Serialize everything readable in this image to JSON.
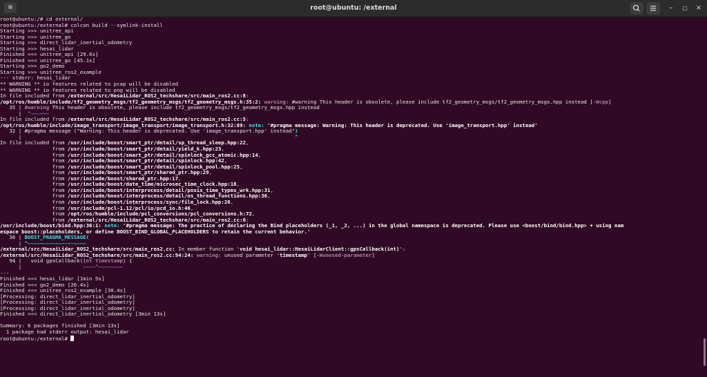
{
  "window": {
    "title": "root@ubuntu: /external",
    "new_tab_icon": "new-tab-icon",
    "search_icon": "search-icon",
    "menu_icon": "hamburger-menu-icon",
    "min_glyph": "–",
    "max_glyph": "▢",
    "close_glyph": "×"
  },
  "colors": {
    "background": "#300a24",
    "text": "#e7e7e7",
    "warning": "#ad7fa8",
    "note": "#34e2e2",
    "caret": "#4e9a06"
  },
  "terminal": {
    "lines": [
      [
        {
          "t": "root@ubuntu:/# cd external/"
        }
      ],
      [
        {
          "t": "root@ubuntu:/external# colcon build --symlink-install"
        }
      ],
      [
        {
          "t": "Starting >>> unitree_api"
        }
      ],
      [
        {
          "t": "Starting >>> unitree_go"
        }
      ],
      [
        {
          "t": "Starting >>> direct_lidar_inertial_odometry"
        }
      ],
      [
        {
          "t": "Starting >>> hesai_lidar"
        }
      ],
      [
        {
          "t": "Finished <<< unitree_api [29.6s]"
        }
      ],
      [
        {
          "t": "Finished <<< unitree_go [45.1s]"
        }
      ],
      [
        {
          "t": "Starting >>> go2_demo"
        }
      ],
      [
        {
          "t": "Starting >>> unitree_ros2_example"
        }
      ],
      [
        {
          "t": "--- stderr: hesai_lidar"
        }
      ],
      [
        {
          "t": "** WARNING ** io features related to pcap will be disabled"
        }
      ],
      [
        {
          "t": "** WARNING ** io features related to png will be disabled"
        }
      ],
      [
        {
          "t": "In file included from "
        },
        {
          "t": "/external/src/HesaiLidar_ROS2_techshare/src/main_ros2.cc:8",
          "c": "b"
        },
        {
          "t": ":"
        }
      ],
      [
        {
          "t": "/opt/ros/humble/include/tf2_geometry_msgs/tf2_geometry_msgs/tf2_geometry_msgs.h:35:2:",
          "c": "b"
        },
        {
          "t": " "
        },
        {
          "t": "warning:",
          "c": "warn"
        },
        {
          "t": " #warning This header is obsolete, please include tf2_geometry_msgs/tf2_geometry_msgs.hpp instead ["
        },
        {
          "t": "-Wcpp",
          "c": "warn"
        },
        {
          "t": "]"
        }
      ],
      [
        {
          "t": "   35 | "
        },
        {
          "t": "#warning",
          "c": "warn"
        },
        {
          "t": " This header is obsolete, please include tf2_geometry_msgs/tf2_geometry_msgs.hpp instead"
        }
      ],
      [
        {
          "t": "      | "
        },
        {
          "t": " ^~~~~~~",
          "c": "warn"
        }
      ],
      [
        {
          "t": "In file included from "
        },
        {
          "t": "/external/src/HesaiLidar_ROS2_techshare/src/main_ros2.cc:5",
          "c": "b"
        },
        {
          "t": ":"
        }
      ],
      [
        {
          "t": "/opt/ros/humble/include/image_transport/image_transport/image_transport.h:32:89:",
          "c": "b"
        },
        {
          "t": " "
        },
        {
          "t": "note:",
          "c": "note"
        },
        {
          "t": " "
        },
        {
          "t": "'#pragma message: Warning: This header is deprecated. Use 'image_transport.hpp' instead'",
          "c": "b"
        }
      ],
      [
        {
          "t": "   32 | #pragma message (\"Warning: This header is deprecated. Use 'image_transport.hpp' instead\""
        },
        {
          "t": ")",
          "c": "note"
        }
      ],
      [
        {
          "t": "      |                                                                                         "
        },
        {
          "t": "^",
          "c": "note"
        }
      ],
      [
        {
          "t": "In file included from "
        },
        {
          "t": "/usr/include/boost/smart_ptr/detail/sp_thread_sleep.hpp:22",
          "c": "b"
        },
        {
          "t": ","
        }
      ],
      [
        {
          "t": "                 from "
        },
        {
          "t": "/usr/include/boost/smart_ptr/detail/yield_k.hpp:23",
          "c": "b"
        },
        {
          "t": ","
        }
      ],
      [
        {
          "t": "                 from "
        },
        {
          "t": "/usr/include/boost/smart_ptr/detail/spinlock_gcc_atomic.hpp:14",
          "c": "b"
        },
        {
          "t": ","
        }
      ],
      [
        {
          "t": "                 from "
        },
        {
          "t": "/usr/include/boost/smart_ptr/detail/spinlock.hpp:42",
          "c": "b"
        },
        {
          "t": ","
        }
      ],
      [
        {
          "t": "                 from "
        },
        {
          "t": "/usr/include/boost/smart_ptr/detail/spinlock_pool.hpp:25",
          "c": "b"
        },
        {
          "t": ","
        }
      ],
      [
        {
          "t": "                 from "
        },
        {
          "t": "/usr/include/boost/smart_ptr/shared_ptr.hpp:29",
          "c": "b"
        },
        {
          "t": ","
        }
      ],
      [
        {
          "t": "                 from "
        },
        {
          "t": "/usr/include/boost/shared_ptr.hpp:17",
          "c": "b"
        },
        {
          "t": ","
        }
      ],
      [
        {
          "t": "                 from "
        },
        {
          "t": "/usr/include/boost/date_time/microsec_time_clock.hpp:18",
          "c": "b"
        },
        {
          "t": ","
        }
      ],
      [
        {
          "t": "                 from "
        },
        {
          "t": "/usr/include/boost/interprocess/detail/posix_time_types_wrk.hpp:31",
          "c": "b"
        },
        {
          "t": ","
        }
      ],
      [
        {
          "t": "                 from "
        },
        {
          "t": "/usr/include/boost/interprocess/detail/os_thread_functions.hpp:36",
          "c": "b"
        },
        {
          "t": ","
        }
      ],
      [
        {
          "t": "                 from "
        },
        {
          "t": "/usr/include/boost/interprocess/sync/file_lock.hpp:26",
          "c": "b"
        },
        {
          "t": ","
        }
      ],
      [
        {
          "t": "                 from "
        },
        {
          "t": "/usr/include/pcl-1.12/pcl/io/pcd_io.h:46",
          "c": "b"
        },
        {
          "t": ","
        }
      ],
      [
        {
          "t": "                 from "
        },
        {
          "t": "/opt/ros/humble/include/pcl_conversions/pcl_conversions.h:72",
          "c": "b"
        },
        {
          "t": ","
        }
      ],
      [
        {
          "t": "                 from "
        },
        {
          "t": "/external/src/HesaiLidar_ROS2_techshare/src/main_ros2.cc:6",
          "c": "b"
        },
        {
          "t": ":"
        }
      ],
      [
        {
          "t": "/usr/include/boost/bind.hpp:36:1:",
          "c": "b"
        },
        {
          "t": " "
        },
        {
          "t": "note:",
          "c": "note"
        },
        {
          "t": " "
        },
        {
          "t": "'#pragma message: The practice of declaring the Bind placeholders (_1, _2, ...) in the global namespace is deprecated. Please use <boost/bind/bind.hpp> + using nam",
          "c": "b"
        }
      ],
      [
        {
          "t": "espace boost::placeholders, or define BOOST_BIND_GLOBAL_PLACEHOLDERS to retain the current behavior.'",
          "c": "b"
        }
      ],
      [
        {
          "t": "   36 | "
        },
        {
          "t": "BOOST_PRAGMA_MESSAGE",
          "c": "note"
        },
        {
          "t": "("
        }
      ],
      [
        {
          "t": "      | "
        },
        {
          "t": "^~~~~~~~~~~~~~~~~~~~",
          "c": "note"
        }
      ],
      [
        {
          "t": "/external/src/HesaiLidar_ROS2_techshare/src/main_ros2.cc:",
          "c": "b"
        },
        {
          "t": " In member function '"
        },
        {
          "t": "void hesai_lidar::HesaiLidarClient::gpsCallback(int)",
          "c": "b"
        },
        {
          "t": "':"
        }
      ],
      [
        {
          "t": "/external/src/HesaiLidar_ROS2_techshare/src/main_ros2.cc:94:24:",
          "c": "b"
        },
        {
          "t": " "
        },
        {
          "t": "warning:",
          "c": "warn"
        },
        {
          "t": " unused parameter '"
        },
        {
          "t": "timestamp",
          "c": "b"
        },
        {
          "t": "' ["
        },
        {
          "t": "-Wunused-parameter",
          "c": "warn"
        },
        {
          "t": "]"
        }
      ],
      [
        {
          "t": "   94 |   void gpsCallback("
        },
        {
          "t": "int timestamp",
          "c": "warn"
        },
        {
          "t": ") {"
        }
      ],
      [
        {
          "t": "      |                    "
        },
        {
          "t": "~~~~^~~~~~~~~",
          "c": "warn"
        }
      ],
      [
        {
          "t": "---"
        }
      ],
      [
        {
          "t": "Finished <<< hesai_lidar [1min 5s]"
        }
      ],
      [
        {
          "t": "Finished <<< go2_demo [26.4s]"
        }
      ],
      [
        {
          "t": "Finished <<< unitree_ros2_example [30.4s]"
        }
      ],
      [
        {
          "t": "[Processing: direct_lidar_inertial_odometry]"
        }
      ],
      [
        {
          "t": "[Processing: direct_lidar_inertial_odometry]"
        }
      ],
      [
        {
          "t": "[Processing: direct_lidar_inertial_odometry]"
        }
      ],
      [
        {
          "t": "Finished <<< direct_lidar_inertial_odometry [3min 13s]"
        }
      ],
      [
        {
          "t": ""
        }
      ],
      [
        {
          "t": "Summary: 6 packages finished [3min 13s]"
        }
      ],
      [
        {
          "t": "  1 package had stderr output: hesai_lidar"
        }
      ],
      [
        {
          "t": "root@ubuntu:/external# "
        }
      ]
    ]
  }
}
